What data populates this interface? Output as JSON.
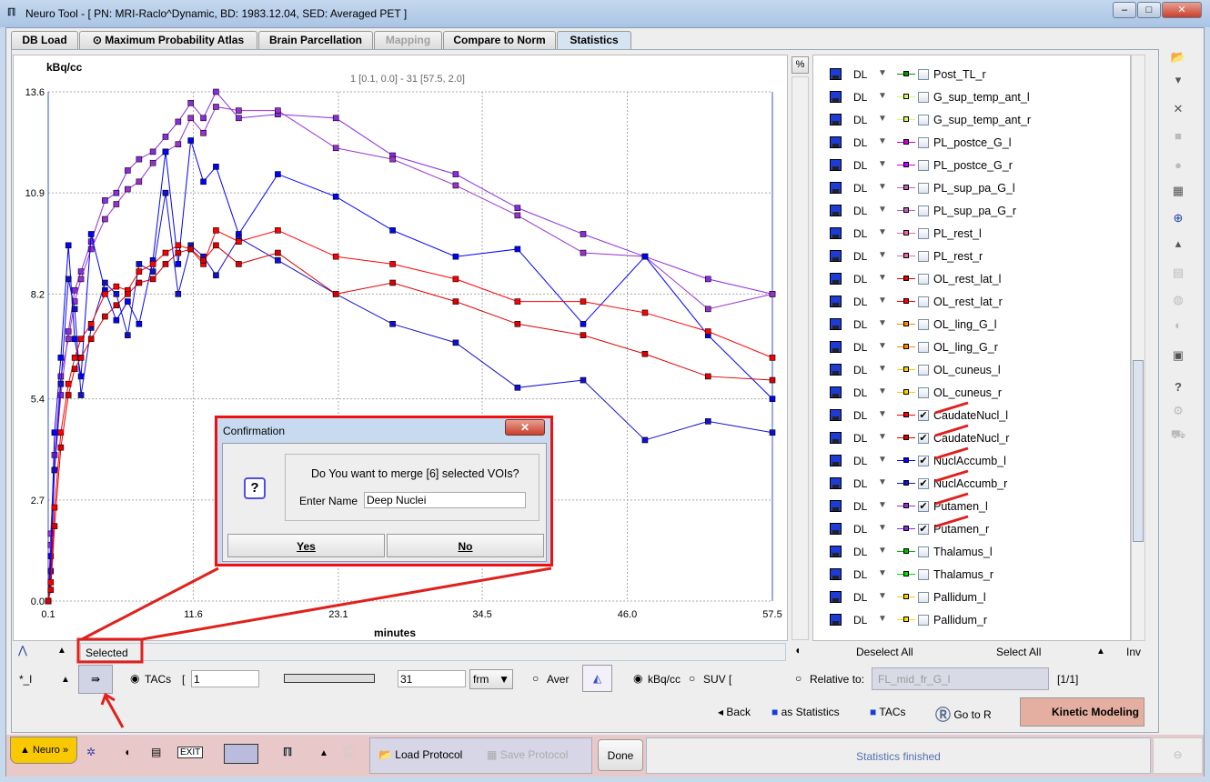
{
  "window": {
    "title": "Neuro Tool - [ PN: MRI-Raclo^Dynamic, BD: 1983.12.04, SED: Averaged PET ]",
    "min": "–",
    "max": "□",
    "close": "✕"
  },
  "tabs": [
    {
      "label": "DB Load"
    },
    {
      "label": "Maximum Probability Atlas"
    },
    {
      "label": "Brain Parcellation"
    },
    {
      "label": "Mapping"
    },
    {
      "label": "Compare to Norm"
    },
    {
      "label": "Statistics"
    }
  ],
  "chart_data": {
    "type": "line",
    "ylabel": "kBq/cc",
    "xlabel": "minutes",
    "range_label": "1 [0.1, 0.0] - 31 [57.5, 2.0]",
    "xlim": [
      0.1,
      57.5
    ],
    "ylim": [
      0,
      13.6
    ],
    "xticks": [
      "0.1",
      "11.6",
      "23.1",
      "34.5",
      "46.0",
      "57.5"
    ],
    "yticks": [
      "0.0",
      "2.7",
      "5.4",
      "8.2",
      "10.9",
      "13.6"
    ],
    "grid": true,
    "x": [
      0.1,
      0.3,
      0.6,
      1.1,
      1.7,
      2.2,
      2.7,
      3.5,
      4.6,
      5.5,
      6.4,
      7.3,
      8.4,
      9.4,
      10.4,
      11.4,
      12.4,
      13.4,
      15.2,
      18.3,
      22.9,
      27.4,
      32.4,
      37.3,
      42.5,
      47.4,
      52.4,
      57.5
    ],
    "series": [
      {
        "color": "#8a2be2",
        "values": [
          0,
          1.5,
          3.5,
          5.5,
          7.2,
          8.3,
          8.8,
          9.6,
          10.7,
          10.9,
          11.5,
          11.8,
          12.0,
          12.4,
          12.8,
          13.3,
          12.9,
          13.6,
          12.9,
          13.0,
          12.9,
          11.9,
          11.4,
          10.5,
          9.8,
          9.2,
          8.6,
          8.2
        ]
      },
      {
        "color": "#9b30d0",
        "values": [
          0,
          1.8,
          3.9,
          6.0,
          7.0,
          8.0,
          8.6,
          9.4,
          10.2,
          10.6,
          11.0,
          11.2,
          11.7,
          12.0,
          12.2,
          12.9,
          12.5,
          13.2,
          13.1,
          13.1,
          12.1,
          11.8,
          11.1,
          10.3,
          9.3,
          9.2,
          7.8,
          8.2
        ]
      },
      {
        "color": "#0000ff",
        "values": [
          0,
          1.2,
          4.5,
          6.5,
          9.5,
          7.0,
          6.0,
          9.8,
          8.3,
          7.5,
          8.0,
          7.4,
          9.1,
          12.0,
          9.0,
          12.3,
          11.2,
          11.6,
          9.8,
          11.4,
          10.8,
          9.9,
          9.2,
          9.4,
          7.4,
          9.2,
          7.1,
          5.4
        ]
      },
      {
        "color": "#1010d0",
        "values": [
          0,
          0.8,
          3.5,
          5.8,
          8.6,
          7.8,
          5.5,
          7.3,
          8.5,
          8.2,
          7.1,
          9.0,
          8.8,
          10.9,
          8.2,
          9.5,
          9.2,
          8.7,
          9.7,
          9.1,
          8.2,
          7.4,
          6.9,
          5.7,
          5.9,
          4.3,
          4.8,
          4.5
        ]
      },
      {
        "color": "#ff0000",
        "values": [
          0,
          0.5,
          2.5,
          4.5,
          5.8,
          6.5,
          7.0,
          7.4,
          8.2,
          8.4,
          8.3,
          8.8,
          9.0,
          9.3,
          9.5,
          9.4,
          9.0,
          9.9,
          9.6,
          9.9,
          9.2,
          9.0,
          8.6,
          8.0,
          8.0,
          7.7,
          7.2,
          6.5
        ]
      },
      {
        "color": "#dd0000",
        "values": [
          0,
          0.3,
          2.0,
          4.1,
          5.5,
          6.2,
          6.5,
          7.0,
          7.6,
          7.9,
          8.2,
          8.5,
          8.6,
          9.0,
          9.3,
          9.4,
          9.1,
          9.5,
          9.0,
          9.3,
          8.2,
          8.5,
          8.0,
          7.4,
          7.1,
          6.6,
          6.0,
          5.9
        ]
      }
    ]
  },
  "percent_button": "%",
  "vois": [
    {
      "type": "DL",
      "name": "Post_TL_r",
      "color": "#009900",
      "checked": false
    },
    {
      "type": "DL",
      "name": "G_sup_temp_ant_l",
      "color": "#ccff66",
      "checked": false
    },
    {
      "type": "DL",
      "name": "G_sup_temp_ant_r",
      "color": "#ccff66",
      "checked": false
    },
    {
      "type": "DL",
      "name": "PL_postce_G_l",
      "color": "#cc00cc",
      "checked": false
    },
    {
      "type": "DL",
      "name": "PL_postce_G_r",
      "color": "#cc00ff",
      "checked": false
    },
    {
      "type": "DL",
      "name": "PL_sup_pa_G_l",
      "color": "#bb66bb",
      "checked": false
    },
    {
      "type": "DL",
      "name": "PL_sup_pa_G_r",
      "color": "#bb66bb",
      "checked": false
    },
    {
      "type": "DL",
      "name": "PL_rest_l",
      "color": "#ee66aa",
      "checked": false
    },
    {
      "type": "DL",
      "name": "PL_rest_r",
      "color": "#ee66aa",
      "checked": false
    },
    {
      "type": "DL",
      "name": "OL_rest_lat_l",
      "color": "#dd0000",
      "checked": false
    },
    {
      "type": "DL",
      "name": "OL_rest_lat_r",
      "color": "#ff0000",
      "checked": false
    },
    {
      "type": "DL",
      "name": "OL_ling_G_l",
      "color": "#ff8800",
      "checked": false
    },
    {
      "type": "DL",
      "name": "OL_ling_G_r",
      "color": "#ff8800",
      "checked": false
    },
    {
      "type": "DL",
      "name": "OL_cuneus_l",
      "color": "#ffcc00",
      "checked": false
    },
    {
      "type": "DL",
      "name": "OL_cuneus_r",
      "color": "#ffcc00",
      "checked": false
    },
    {
      "type": "DL",
      "name": "CaudateNucl_l",
      "color": "#ff0000",
      "checked": true
    },
    {
      "type": "DL",
      "name": "CaudateNucl_r",
      "color": "#dd0000",
      "checked": true
    },
    {
      "type": "DL",
      "name": "NuclAccumb_l",
      "color": "#0000ff",
      "checked": true
    },
    {
      "type": "DL",
      "name": "NuclAccumb_r",
      "color": "#1010d0",
      "checked": true
    },
    {
      "type": "DL",
      "name": "Putamen_l",
      "color": "#9b30d0",
      "checked": true
    },
    {
      "type": "DL",
      "name": "Putamen_r",
      "color": "#8a2be2",
      "checked": true
    },
    {
      "type": "DL",
      "name": "Thalamus_l",
      "color": "#00bb00",
      "checked": false
    },
    {
      "type": "DL",
      "name": "Thalamus_r",
      "color": "#00dd00",
      "checked": false
    },
    {
      "type": "DL",
      "name": "Pallidum_l",
      "color": "#ffcc00",
      "checked": false
    },
    {
      "type": "DL",
      "name": "Pallidum_r",
      "color": "#ffdd00",
      "checked": false
    }
  ],
  "controls": {
    "selected": "Selected",
    "deselect_all": "Deselect All",
    "select_all": "Select All",
    "inv": "Inv",
    "star_label": "*_l",
    "tacs": "TACs",
    "from": "1",
    "to": "31",
    "unit": "frm",
    "aver": "Aver",
    "kbq": "kBq/cc",
    "suv": "SUV [",
    "relative": "Relative to:",
    "relative_value": "FL_mid_fr_G_l",
    "page": "[1/1]",
    "back": "Back",
    "as_statistics": "as Statistics",
    "tacs_save": "TACs",
    "go_to_r": "Go to R",
    "kinetic": "Kinetic Modeling"
  },
  "dialog": {
    "title": "Confirmation",
    "message": "Do You want to merge [6] selected VOIs?",
    "name_label": "Enter Name",
    "name_value": "Deep Nuclei",
    "yes": "Yes",
    "no": "No",
    "icon": "?"
  },
  "footer": {
    "neuro": "Neuro »",
    "load_protocol": "Load Protocol",
    "save_protocol": "Save Protocol",
    "done": "Done",
    "status": "Statistics finished"
  }
}
